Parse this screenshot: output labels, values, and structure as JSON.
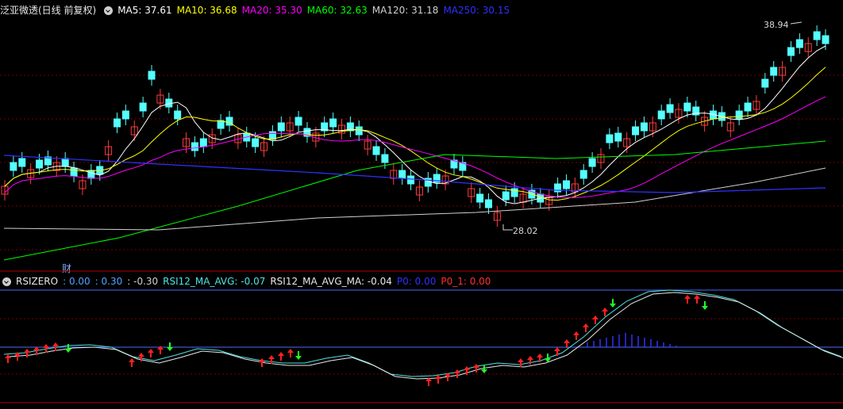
{
  "main_legend": {
    "title": "泛亚微透(日线 前复权)",
    "items": [
      {
        "text": "MA5: 37.61",
        "color": "#ffffff"
      },
      {
        "text": "MA10: 36.68",
        "color": "#ffff00"
      },
      {
        "text": "MA20: 35.30",
        "color": "#ff00ff"
      },
      {
        "text": "MA60: 32.63",
        "color": "#00ff00"
      },
      {
        "text": "MA120: 31.18",
        "color": "#d0d0d0"
      },
      {
        "text": "MA250: 30.15",
        "color": "#3030ff"
      }
    ]
  },
  "indicator_legend": {
    "title": "RSIZERO",
    "items": [
      {
        "text": ": 0.00",
        "color": "#4fa3ff"
      },
      {
        "text": ": 0.30",
        "color": "#4fa3ff"
      },
      {
        "text": ": -0.30",
        "color": "#cfcfcf"
      },
      {
        "text": "RSI12_MA_AVG: -0.07",
        "color": "#4fe3e3"
      },
      {
        "text": "RSI12_MA_AVG_MA: -0.04",
        "color": "#e8e8e8"
      },
      {
        "text": "P0: 0.00",
        "color": "#3030ff"
      },
      {
        "text": "P0_1: 0.00",
        "color": "#ff3030"
      }
    ]
  },
  "annotations": {
    "high_label": "38.94",
    "low_label": "28.02",
    "cai_marker": "财"
  },
  "colors": {
    "up": "#ff3b3b",
    "down": "#54ffff",
    "grid": "#7a0000",
    "divider": "#b00000",
    "arrow_up": "#ff2020",
    "arrow_down": "#20ff20"
  }
}
